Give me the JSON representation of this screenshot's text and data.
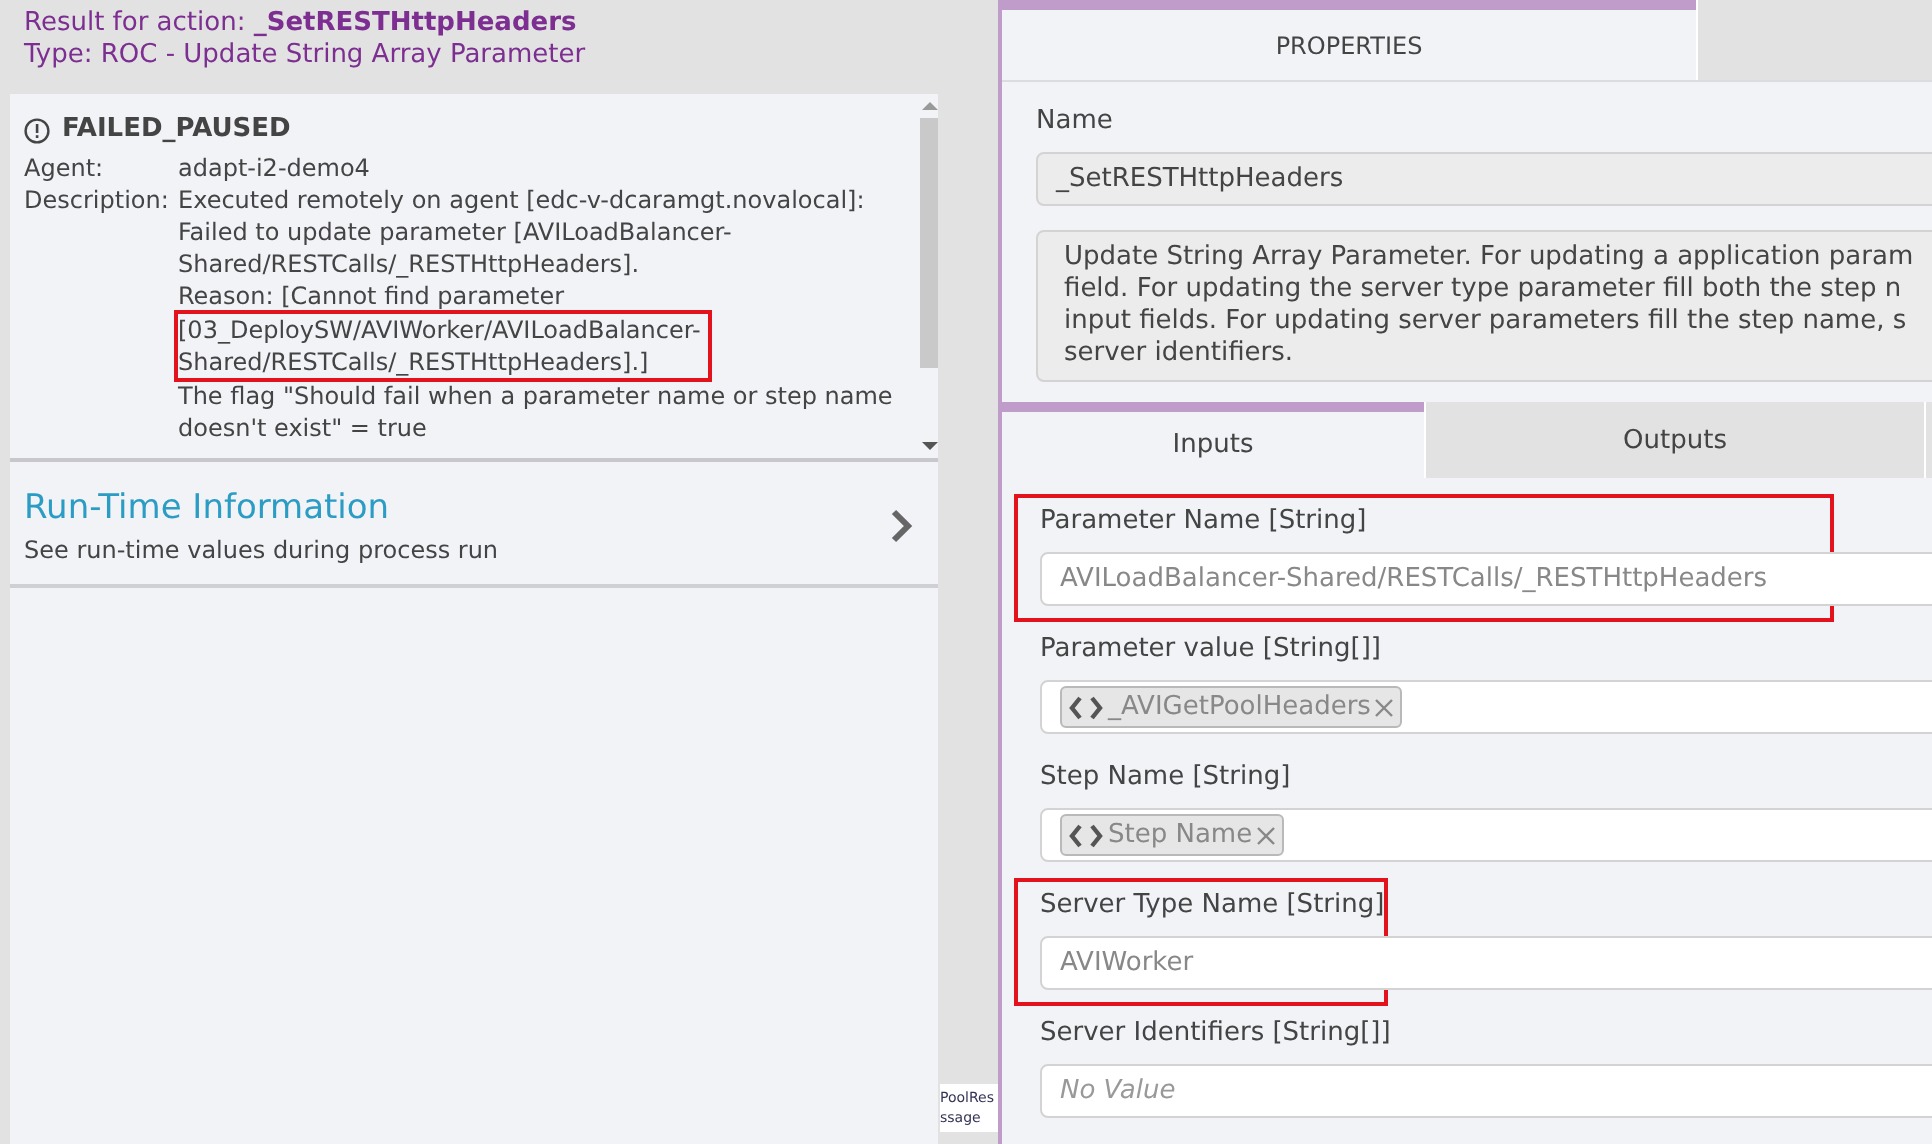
{
  "result_header": {
    "title": "Result for action: **_SetRESTHttpHeaders**",
    "type": "Type: ROC - Update String Array Parameter"
  },
  "result_details": {
    "status": "FAILED_PAUSED",
    "rows": [
      {
        "label": "Agent:",
        "lines": [
          {
            "text": "adapt-i2-demo4",
            "highlighted": false
          }
        ]
      },
      {
        "label": "Description:",
        "lines": [
          {
            "text": "Executed remotely on agent [edc-v-dcaramgt.novalocal]:",
            "highlighted": false
          },
          {
            "text": "Failed to update parameter [AVILoadBalancer-",
            "highlighted": false
          },
          {
            "text": "Shared/RESTCalls/_RESTHttpHeaders].",
            "highlighted": false
          },
          {
            "text": "Reason: [Cannot find parameter",
            "highlighted": false
          },
          {
            "text": "[03_DeploySW/AVIWorker/AVILoadBalancer-",
            "highlighted": true
          },
          {
            "text": "Shared/RESTCalls/_RESTHttpHeaders].]",
            "highlighted": true
          },
          {
            "text": "The flag \"Should fail when a parameter name or step name",
            "highlighted": false
          },
          {
            "text": "doesn't exist\" = true",
            "highlighted": false
          }
        ]
      }
    ]
  },
  "runtime_section": {
    "title": "Run-Time Information",
    "subtitle": "See run-time values during process run"
  },
  "canvas_fragments": [
    "PoolRes",
    "ssage"
  ],
  "properties_panel": {
    "tabs": [
      {
        "label": "PROPERTIES",
        "selected": true
      },
      {
        "selected": false
      }
    ],
    "name_label": "Name",
    "name_value": "_SetRESTHttpHeaders",
    "description_lines": [
      "Update String Array Parameter. For updating a application param",
      "field. For updating the server type parameter fill both the step n",
      "input fields. For updating server parameters fill the step name, s",
      "server identifiers."
    ],
    "sub_tabs": [
      {
        "label": "Inputs",
        "selected": true
      },
      {
        "label": "Outputs",
        "selected": false
      },
      {
        "selected": false
      }
    ],
    "inputs": [
      {
        "kind": "text",
        "label": "Parameter Name [String]",
        "value": "AVILoadBalancer-Shared/RESTCalls/_RESTHttpHeaders",
        "highlighted": true
      },
      {
        "kind": "tags",
        "label": "Parameter value [String[]]",
        "tags": [
          "_AVIGetPoolHeaders"
        ],
        "highlighted": false
      },
      {
        "kind": "tags",
        "label": "Step Name [String]",
        "tags": [
          "Step Name"
        ],
        "highlighted": false
      },
      {
        "kind": "text",
        "label": "Server Type Name [String]",
        "value": "AVIWorker",
        "highlighted": true
      },
      {
        "kind": "empty",
        "label": "Server Identifiers [String[]]",
        "placeholder": "No Value",
        "highlighted": false
      }
    ]
  }
}
